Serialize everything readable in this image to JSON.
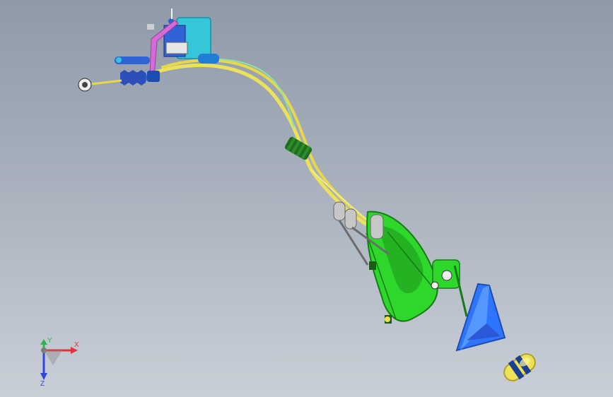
{
  "viewport": {
    "background_top": "#8f9aa9",
    "background_bottom": "#c9cfd7"
  },
  "model": {
    "parts": [
      "shift-tower-icon",
      "cable-bracket-icon",
      "cable-end-fitting-icon",
      "bellows-boot-icon",
      "cable-grommet-icon",
      "shifter-base-bracket-icon",
      "shift-lever-boot-icon",
      "shift-knob-icon"
    ],
    "colors": {
      "cyan": "#35c6d8",
      "blue": "#2f63d6",
      "magenta": "#d66ad6",
      "yellow": "#ece25a",
      "green": "#2ed82a",
      "dark_green": "#187a17"
    }
  },
  "triad": {
    "x_label": "X",
    "y_label": "Y",
    "z_label": "Z",
    "x_color": "#e1343a",
    "y_color": "#2fb54a",
    "z_color": "#3346d6"
  }
}
